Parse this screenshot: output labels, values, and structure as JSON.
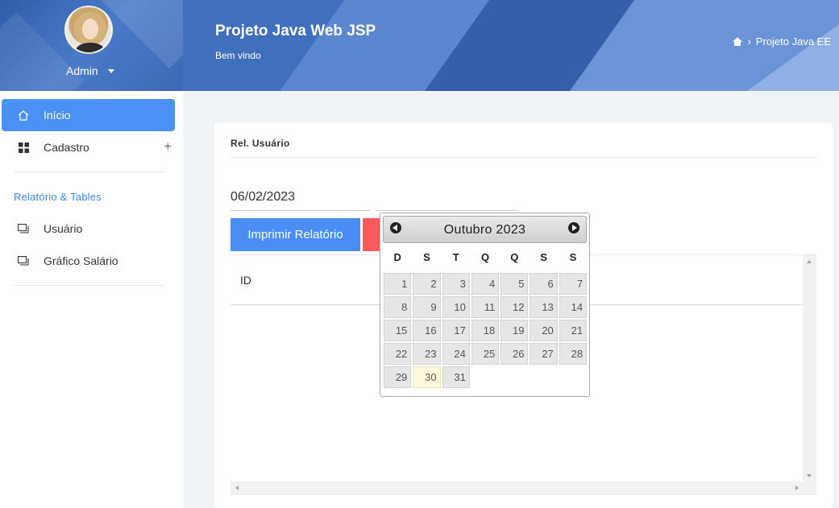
{
  "sidebar": {
    "user_name": "Admin",
    "items": [
      {
        "label": "Início",
        "icon": "home-icon",
        "active": true
      },
      {
        "label": "Cadastro",
        "icon": "grid-icon",
        "expand": "+"
      }
    ],
    "section_title": "Relatório & Tables",
    "reports": [
      {
        "label": "Usuário",
        "icon": "window-icon"
      },
      {
        "label": "Gráfico Salário",
        "icon": "window-icon"
      }
    ]
  },
  "header": {
    "title": "Projeto Java Web JSP",
    "subtitle": "Bem vindo",
    "breadcrumb_separator": "›",
    "breadcrumb_current": "Projeto Java EE"
  },
  "card": {
    "title": "Rel. Usuário",
    "date_start": "06/02/2023",
    "print_button": "Imprimir Relatório",
    "table_header_id": "ID"
  },
  "datepicker": {
    "month_year": "Outubro 2023",
    "weekdays": [
      "D",
      "S",
      "T",
      "Q",
      "Q",
      "S",
      "S"
    ],
    "days": [
      "1",
      "2",
      "3",
      "4",
      "5",
      "6",
      "7",
      "8",
      "9",
      "10",
      "11",
      "12",
      "13",
      "14",
      "15",
      "16",
      "17",
      "18",
      "19",
      "20",
      "21",
      "22",
      "23",
      "24",
      "25",
      "26",
      "27",
      "28",
      "29",
      "30",
      "31"
    ],
    "highlighted_day": "30"
  },
  "colors": {
    "accent": "#4a90f5",
    "danger": "#fc5a5a",
    "header_blue": "#4a7bc8",
    "section_blue": "#3f86e0"
  }
}
